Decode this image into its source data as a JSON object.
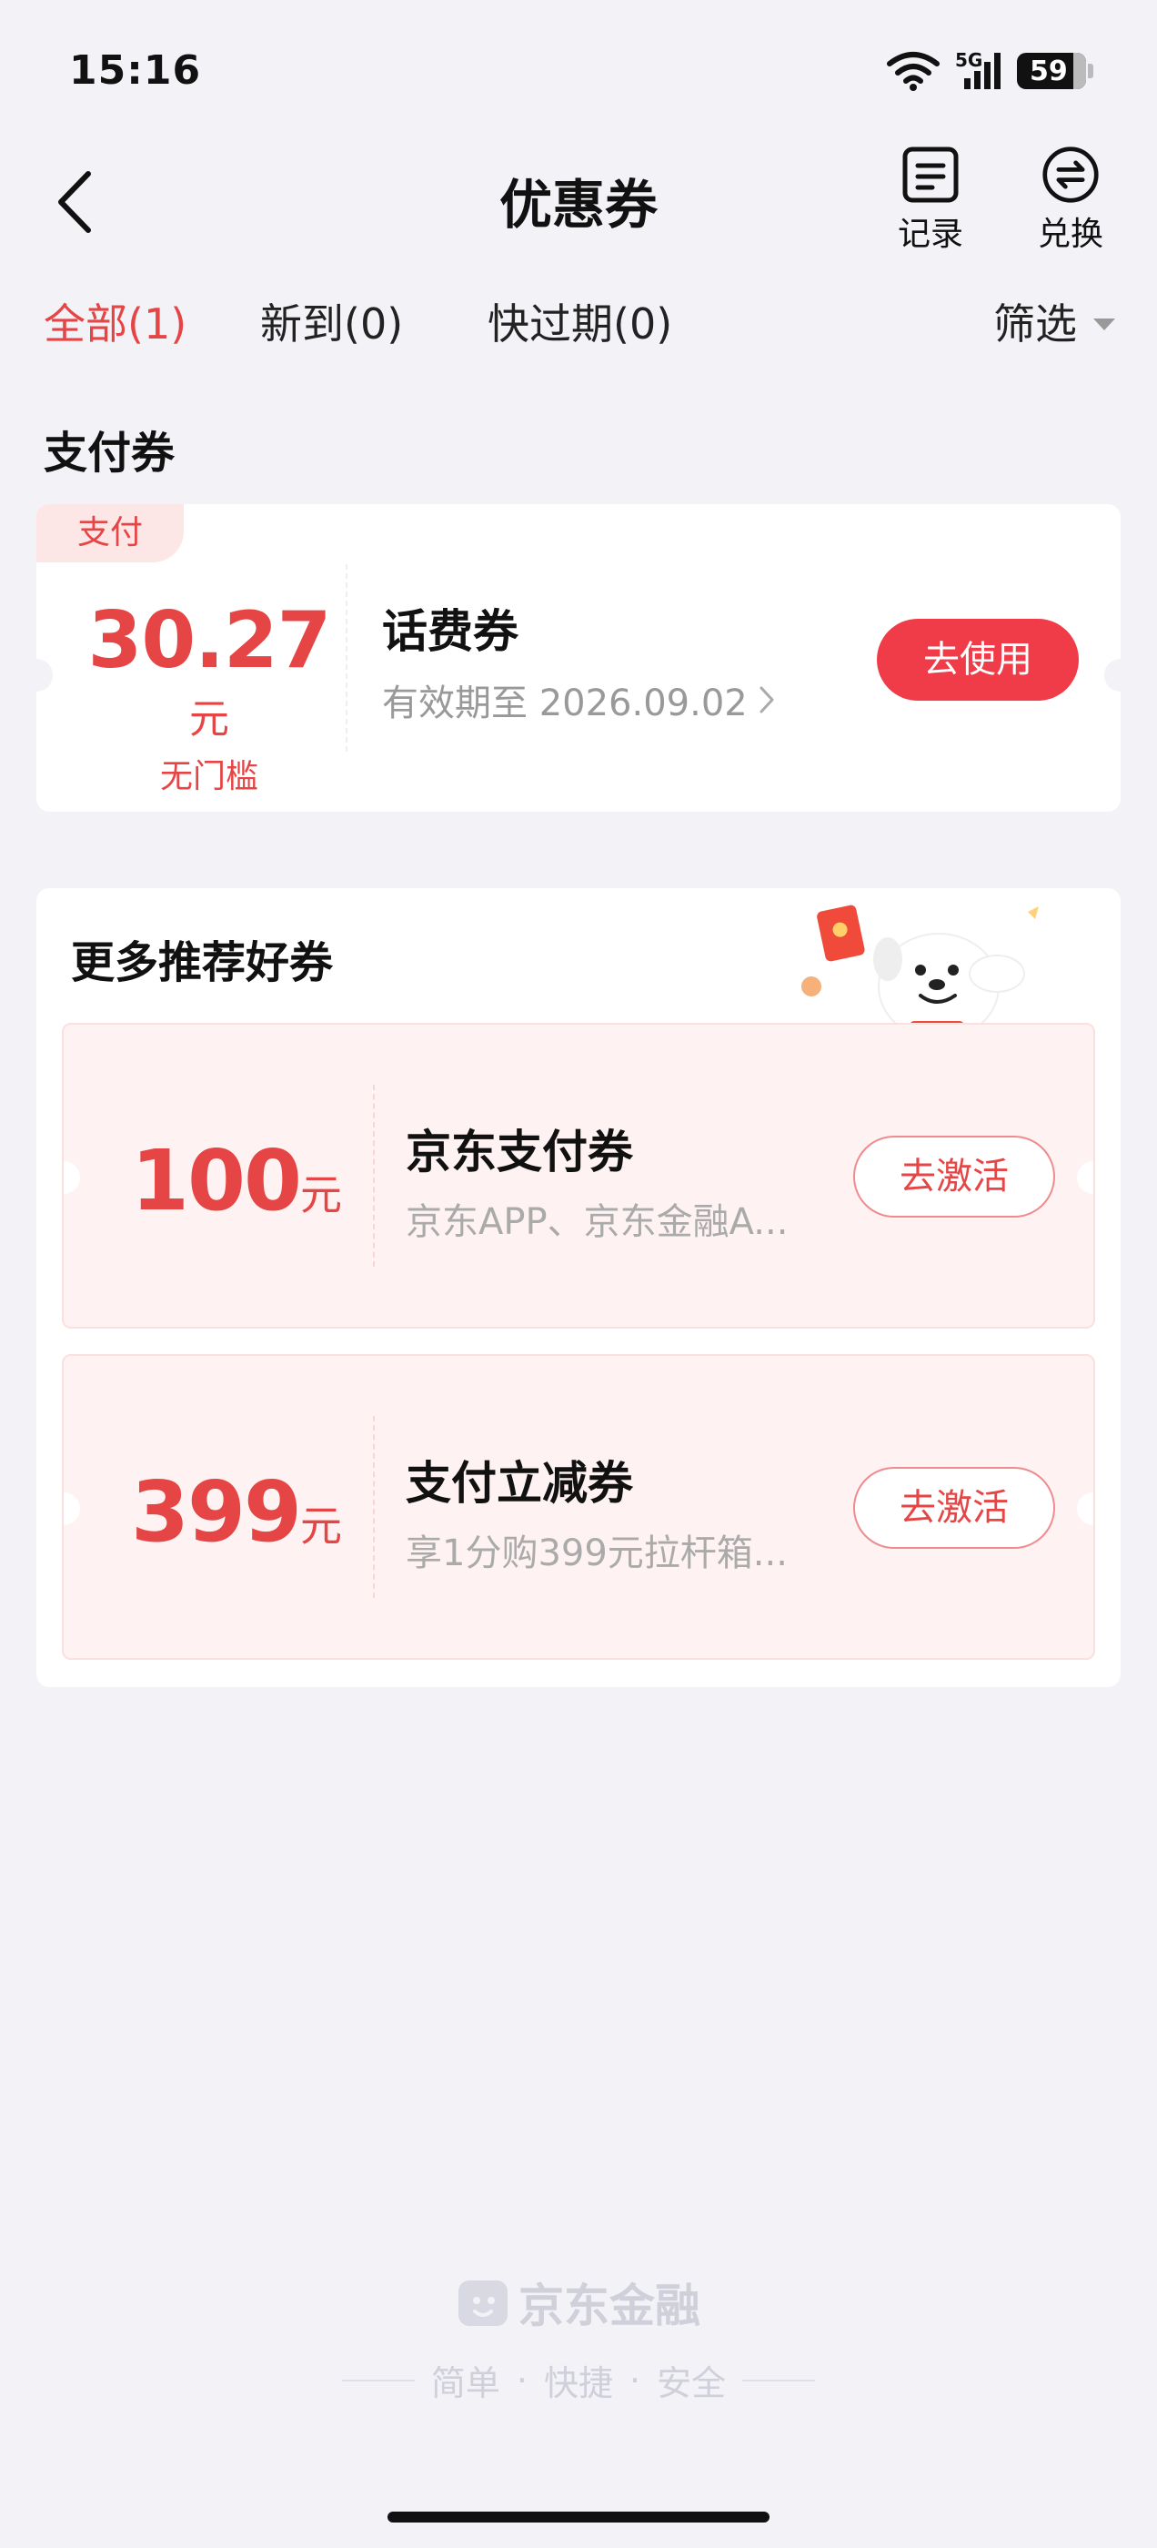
{
  "status_bar": {
    "time": "15:16",
    "network": "5G",
    "battery": "59"
  },
  "header": {
    "title": "优惠券",
    "record_label": "记录",
    "exchange_label": "兑换"
  },
  "tabs": [
    {
      "label": "全部(1)",
      "active": true
    },
    {
      "label": "新到(0)",
      "active": false
    },
    {
      "label": "快过期(0)",
      "active": false
    }
  ],
  "filter_label": "筛选",
  "pay_section": {
    "title": "支付券",
    "coupon": {
      "tag": "支付",
      "amount": "30.27",
      "unit": "元",
      "condition": "无门槛",
      "name": "话费券",
      "expiry": "有效期至 2026.09.02",
      "button": "去使用"
    }
  },
  "recommend": {
    "title": "更多推荐好券",
    "items": [
      {
        "amount": "100",
        "unit": "元",
        "name": "京东支付券",
        "desc": "京东APP、京东金融A...",
        "button": "去激活"
      },
      {
        "amount": "399",
        "unit": "元",
        "name": "支付立减券",
        "desc": "享1分购399元拉杆箱...",
        "button": "去激活"
      }
    ]
  },
  "footer": {
    "brand": "京东金融",
    "slogan": [
      "简单",
      "快捷",
      "安全"
    ]
  },
  "colors": {
    "accent": "#e64545",
    "button_red": "#f03c48",
    "background": "#f2f2f7",
    "coupon_bg": "#fff2f2"
  }
}
